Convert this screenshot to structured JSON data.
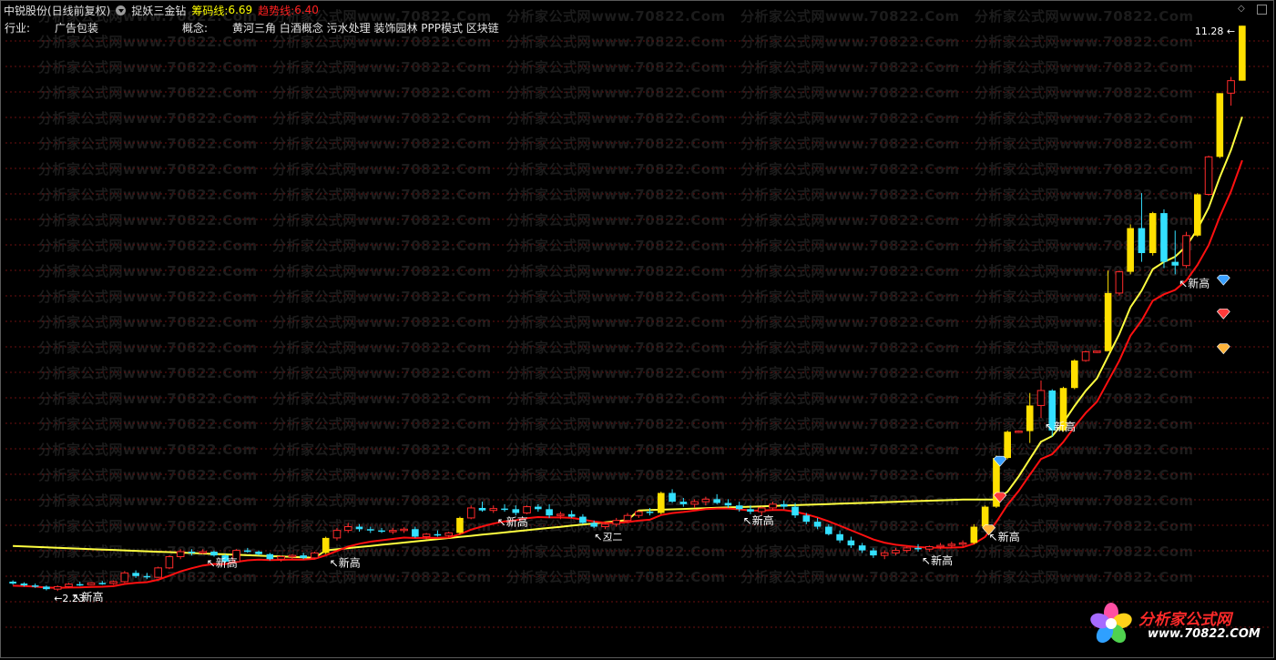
{
  "header": {
    "stock_title": "中锐股份(日线前复权)",
    "indicator_name": "捉妖三金钻",
    "chip_line_label": "筹码线:",
    "chip_line_value": "6.69",
    "trend_line_label": "趋势线:",
    "trend_line_value": "6.40"
  },
  "info": {
    "industry_label": "行业:",
    "industry_value": "广告包装",
    "concept_label": "概念:",
    "concept_value": "黄河三角 白酒概念 污水处理 装饰园林 PPP模式 区块链"
  },
  "watermark": {
    "text": "分析家公式网www.70822.Com"
  },
  "logo": {
    "name": "分析家公式网",
    "url": "www.70822.COM"
  },
  "colors": {
    "background": "#000000",
    "up": "#ff2a2a",
    "down": "#33e0ff",
    "jump": "#ffe000",
    "chip_line": "#ffff40",
    "trend_line": "#ff1010",
    "grid": "#6a1010",
    "text": "#ffffff"
  },
  "chart_data": {
    "type": "candlestick",
    "title": "",
    "y_range": [
      2.0,
      11.4
    ],
    "grid": true,
    "price_high_label": "11.28",
    "price_low_label": "2.23",
    "markers": [
      {
        "text": "新高",
        "index": 5
      },
      {
        "text": "新高",
        "index": 17
      },
      {
        "text": "新高",
        "index": 28
      },
      {
        "text": "新高",
        "index": 43
      },
      {
        "text": "新高",
        "index": 65
      },
      {
        "text": "新高",
        "index": 81
      },
      {
        "text": "新高",
        "index": 87
      },
      {
        "text": "新高",
        "index": 92
      },
      {
        "text": "新高",
        "index": 104
      }
    ],
    "note_label": "丒二",
    "candles": [
      {
        "o": 2.38,
        "h": 2.4,
        "l": 2.33,
        "c": 2.35
      },
      {
        "o": 2.35,
        "h": 2.37,
        "l": 2.3,
        "c": 2.32
      },
      {
        "o": 2.32,
        "h": 2.35,
        "l": 2.28,
        "c": 2.3
      },
      {
        "o": 2.3,
        "h": 2.32,
        "l": 2.24,
        "c": 2.26
      },
      {
        "o": 2.26,
        "h": 2.32,
        "l": 2.23,
        "c": 2.3
      },
      {
        "o": 2.3,
        "h": 2.36,
        "l": 2.28,
        "c": 2.34
      },
      {
        "o": 2.34,
        "h": 2.38,
        "l": 2.31,
        "c": 2.33
      },
      {
        "o": 2.33,
        "h": 2.37,
        "l": 2.32,
        "c": 2.36
      },
      {
        "o": 2.36,
        "h": 2.39,
        "l": 2.33,
        "c": 2.35
      },
      {
        "o": 2.35,
        "h": 2.4,
        "l": 2.33,
        "c": 2.38
      },
      {
        "o": 2.38,
        "h": 2.55,
        "l": 2.36,
        "c": 2.52
      },
      {
        "o": 2.52,
        "h": 2.56,
        "l": 2.44,
        "c": 2.47
      },
      {
        "o": 2.47,
        "h": 2.52,
        "l": 2.42,
        "c": 2.45
      },
      {
        "o": 2.45,
        "h": 2.62,
        "l": 2.44,
        "c": 2.6
      },
      {
        "o": 2.6,
        "h": 2.8,
        "l": 2.58,
        "c": 2.78
      },
      {
        "o": 2.78,
        "h": 2.9,
        "l": 2.74,
        "c": 2.86
      },
      {
        "o": 2.86,
        "h": 2.9,
        "l": 2.8,
        "c": 2.84
      },
      {
        "o": 2.84,
        "h": 2.9,
        "l": 2.82,
        "c": 2.86
      },
      {
        "o": 2.86,
        "h": 2.88,
        "l": 2.78,
        "c": 2.8
      },
      {
        "o": 2.8,
        "h": 2.82,
        "l": 2.68,
        "c": 2.7
      },
      {
        "o": 2.7,
        "h": 2.9,
        "l": 2.69,
        "c": 2.88
      },
      {
        "o": 2.88,
        "h": 2.92,
        "l": 2.84,
        "c": 2.86
      },
      {
        "o": 2.86,
        "h": 2.88,
        "l": 2.8,
        "c": 2.82
      },
      {
        "o": 2.82,
        "h": 2.84,
        "l": 2.72,
        "c": 2.74
      },
      {
        "o": 2.74,
        "h": 2.8,
        "l": 2.7,
        "c": 2.78
      },
      {
        "o": 2.78,
        "h": 2.82,
        "l": 2.74,
        "c": 2.8
      },
      {
        "o": 2.8,
        "h": 2.84,
        "l": 2.74,
        "c": 2.76
      },
      {
        "o": 2.76,
        "h": 2.86,
        "l": 2.74,
        "c": 2.84
      },
      {
        "o": 2.84,
        "h": 3.1,
        "l": 2.82,
        "c": 3.08
      },
      {
        "o": 3.08,
        "h": 3.24,
        "l": 3.04,
        "c": 3.2
      },
      {
        "o": 3.2,
        "h": 3.32,
        "l": 3.16,
        "c": 3.26
      },
      {
        "o": 3.26,
        "h": 3.3,
        "l": 3.18,
        "c": 3.22
      },
      {
        "o": 3.22,
        "h": 3.26,
        "l": 3.16,
        "c": 3.2
      },
      {
        "o": 3.2,
        "h": 3.24,
        "l": 3.16,
        "c": 3.18
      },
      {
        "o": 3.18,
        "h": 3.24,
        "l": 3.14,
        "c": 3.2
      },
      {
        "o": 3.2,
        "h": 3.25,
        "l": 3.16,
        "c": 3.22
      },
      {
        "o": 3.22,
        "h": 3.26,
        "l": 3.08,
        "c": 3.1
      },
      {
        "o": 3.1,
        "h": 3.16,
        "l": 3.06,
        "c": 3.14
      },
      {
        "o": 3.14,
        "h": 3.2,
        "l": 3.1,
        "c": 3.12
      },
      {
        "o": 3.12,
        "h": 3.18,
        "l": 3.08,
        "c": 3.16
      },
      {
        "o": 3.16,
        "h": 3.42,
        "l": 3.14,
        "c": 3.4
      },
      {
        "o": 3.4,
        "h": 3.6,
        "l": 3.38,
        "c": 3.56
      },
      {
        "o": 3.56,
        "h": 3.66,
        "l": 3.5,
        "c": 3.52
      },
      {
        "o": 3.52,
        "h": 3.6,
        "l": 3.48,
        "c": 3.55
      },
      {
        "o": 3.55,
        "h": 3.62,
        "l": 3.5,
        "c": 3.54
      },
      {
        "o": 3.54,
        "h": 3.6,
        "l": 3.44,
        "c": 3.48
      },
      {
        "o": 3.48,
        "h": 3.6,
        "l": 3.46,
        "c": 3.58
      },
      {
        "o": 3.58,
        "h": 3.62,
        "l": 3.5,
        "c": 3.54
      },
      {
        "o": 3.54,
        "h": 3.62,
        "l": 3.4,
        "c": 3.44
      },
      {
        "o": 3.44,
        "h": 3.5,
        "l": 3.38,
        "c": 3.46
      },
      {
        "o": 3.46,
        "h": 3.52,
        "l": 3.4,
        "c": 3.42
      },
      {
        "o": 3.42,
        "h": 3.46,
        "l": 3.3,
        "c": 3.32
      },
      {
        "o": 3.32,
        "h": 3.36,
        "l": 3.24,
        "c": 3.26
      },
      {
        "o": 3.26,
        "h": 3.32,
        "l": 3.22,
        "c": 3.3
      },
      {
        "o": 3.3,
        "h": 3.4,
        "l": 3.26,
        "c": 3.36
      },
      {
        "o": 3.36,
        "h": 3.48,
        "l": 3.32,
        "c": 3.44
      },
      {
        "o": 3.44,
        "h": 3.52,
        "l": 3.4,
        "c": 3.5
      },
      {
        "o": 3.5,
        "h": 3.56,
        "l": 3.44,
        "c": 3.48
      },
      {
        "o": 3.48,
        "h": 3.82,
        "l": 3.46,
        "c": 3.8
      },
      {
        "o": 3.8,
        "h": 3.86,
        "l": 3.64,
        "c": 3.66
      },
      {
        "o": 3.66,
        "h": 3.72,
        "l": 3.58,
        "c": 3.62
      },
      {
        "o": 3.62,
        "h": 3.7,
        "l": 3.56,
        "c": 3.66
      },
      {
        "o": 3.66,
        "h": 3.74,
        "l": 3.6,
        "c": 3.7
      },
      {
        "o": 3.7,
        "h": 3.78,
        "l": 3.62,
        "c": 3.64
      },
      {
        "o": 3.64,
        "h": 3.7,
        "l": 3.56,
        "c": 3.6
      },
      {
        "o": 3.6,
        "h": 3.66,
        "l": 3.5,
        "c": 3.54
      },
      {
        "o": 3.54,
        "h": 3.6,
        "l": 3.46,
        "c": 3.5
      },
      {
        "o": 3.5,
        "h": 3.58,
        "l": 3.44,
        "c": 3.56
      },
      {
        "o": 3.56,
        "h": 3.66,
        "l": 3.52,
        "c": 3.62
      },
      {
        "o": 3.62,
        "h": 3.68,
        "l": 3.54,
        "c": 3.58
      },
      {
        "o": 3.58,
        "h": 3.64,
        "l": 3.4,
        "c": 3.44
      },
      {
        "o": 3.44,
        "h": 3.48,
        "l": 3.3,
        "c": 3.34
      },
      {
        "o": 3.34,
        "h": 3.4,
        "l": 3.22,
        "c": 3.26
      },
      {
        "o": 3.26,
        "h": 3.3,
        "l": 3.12,
        "c": 3.14
      },
      {
        "o": 3.14,
        "h": 3.2,
        "l": 3.0,
        "c": 3.04
      },
      {
        "o": 3.04,
        "h": 3.1,
        "l": 2.92,
        "c": 2.96
      },
      {
        "o": 2.96,
        "h": 3.0,
        "l": 2.84,
        "c": 2.88
      },
      {
        "o": 2.88,
        "h": 2.92,
        "l": 2.76,
        "c": 2.8
      },
      {
        "o": 2.8,
        "h": 2.88,
        "l": 2.74,
        "c": 2.84
      },
      {
        "o": 2.84,
        "h": 2.92,
        "l": 2.8,
        "c": 2.88
      },
      {
        "o": 2.88,
        "h": 2.94,
        "l": 2.84,
        "c": 2.92
      },
      {
        "o": 2.92,
        "h": 2.98,
        "l": 2.86,
        "c": 2.9
      },
      {
        "o": 2.9,
        "h": 2.96,
        "l": 2.86,
        "c": 2.94
      },
      {
        "o": 2.94,
        "h": 3.0,
        "l": 2.9,
        "c": 2.96
      },
      {
        "o": 2.96,
        "h": 3.02,
        "l": 2.92,
        "c": 2.98
      },
      {
        "o": 2.98,
        "h": 3.04,
        "l": 2.94,
        "c": 3.0
      },
      {
        "o": 3.0,
        "h": 3.3,
        "l": 2.98,
        "c": 3.26
      },
      {
        "o": 3.26,
        "h": 3.6,
        "l": 3.24,
        "c": 3.58
      },
      {
        "o": 3.58,
        "h": 4.4,
        "l": 3.56,
        "c": 4.36
      },
      {
        "o": 4.36,
        "h": 4.8,
        "l": 4.34,
        "c": 4.78
      },
      {
        "o": 4.78,
        "h": 4.8,
        "l": 4.76,
        "c": 4.79
      },
      {
        "o": 4.79,
        "h": 5.4,
        "l": 4.6,
        "c": 5.2
      },
      {
        "o": 5.2,
        "h": 5.6,
        "l": 5.0,
        "c": 5.44
      },
      {
        "o": 5.44,
        "h": 5.46,
        "l": 4.7,
        "c": 4.8
      },
      {
        "o": 4.8,
        "h": 5.5,
        "l": 4.78,
        "c": 5.48
      },
      {
        "o": 5.48,
        "h": 5.94,
        "l": 5.46,
        "c": 5.92
      },
      {
        "o": 5.92,
        "h": 6.08,
        "l": 5.9,
        "c": 6.06
      },
      {
        "o": 6.06,
        "h": 6.08,
        "l": 6.04,
        "c": 6.07
      },
      {
        "o": 6.07,
        "h": 7.36,
        "l": 6.8,
        "c": 7.0
      },
      {
        "o": 7.0,
        "h": 7.36,
        "l": 6.96,
        "c": 7.34
      },
      {
        "o": 7.34,
        "h": 8.1,
        "l": 7.3,
        "c": 8.04
      },
      {
        "o": 8.04,
        "h": 8.6,
        "l": 7.5,
        "c": 7.64
      },
      {
        "o": 7.64,
        "h": 8.3,
        "l": 7.6,
        "c": 8.28
      },
      {
        "o": 8.28,
        "h": 8.34,
        "l": 7.4,
        "c": 7.5
      },
      {
        "o": 7.5,
        "h": 8.0,
        "l": 7.3,
        "c": 7.44
      },
      {
        "o": 7.44,
        "h": 7.98,
        "l": 7.4,
        "c": 7.92
      },
      {
        "o": 7.92,
        "h": 8.6,
        "l": 7.9,
        "c": 8.58
      },
      {
        "o": 8.58,
        "h": 9.2,
        "l": 8.56,
        "c": 9.18
      },
      {
        "o": 9.18,
        "h": 10.2,
        "l": 9.16,
        "c": 10.2
      },
      {
        "o": 10.2,
        "h": 10.46,
        "l": 10.0,
        "c": 10.4
      },
      {
        "o": 10.4,
        "h": 11.28,
        "l": 10.4,
        "c": 11.28
      }
    ]
  }
}
